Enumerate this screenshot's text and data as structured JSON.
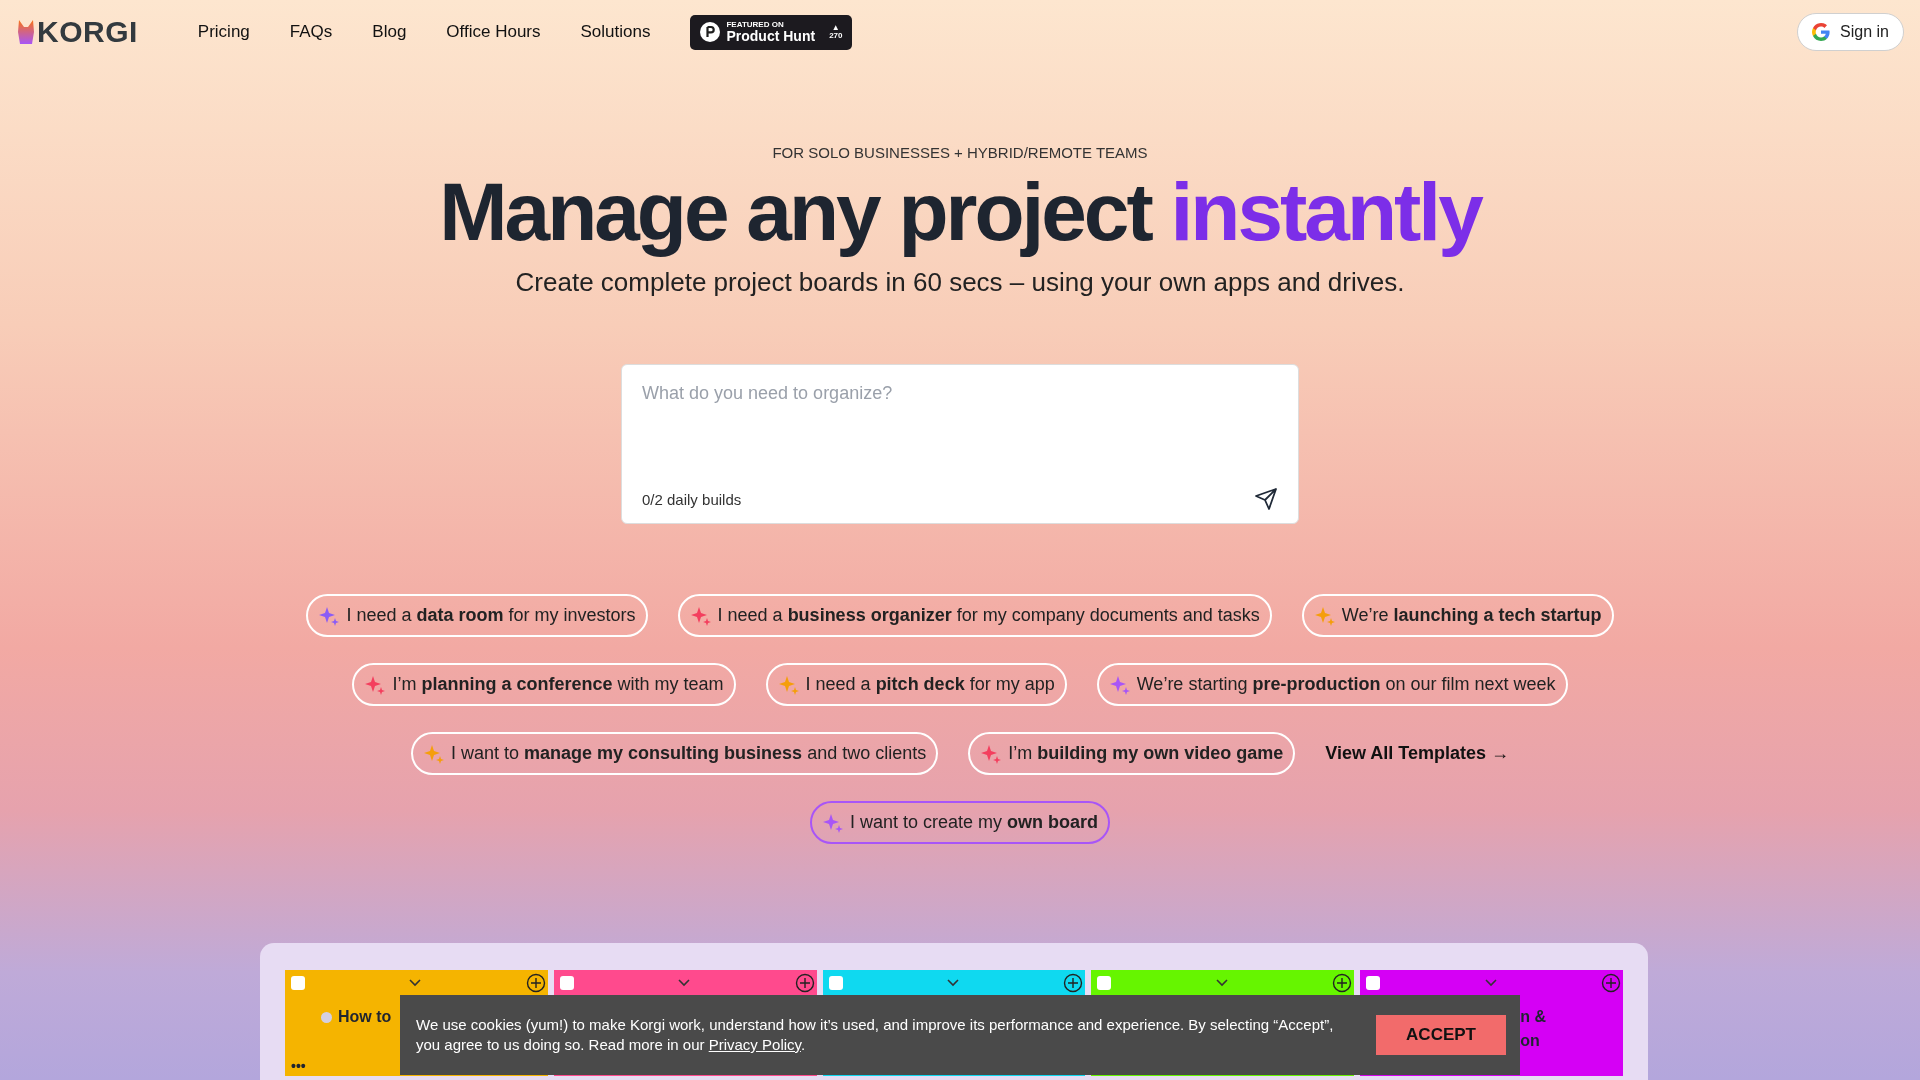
{
  "nav": {
    "logo": "KORGI",
    "links": [
      "Pricing",
      "FAQs",
      "Blog",
      "Office Hours",
      "Solutions"
    ],
    "badge": {
      "small": "FEATURED ON",
      "big": "Product Hunt",
      "votes_mark": "▲",
      "votes": "270"
    },
    "sign_in": "Sign in"
  },
  "hero": {
    "kicker": "FOR SOLO BUSINESSES + HYBRID/REMOTE TEAMS",
    "title": "Manage any project",
    "title_accent": "instantly",
    "subtitle": "Create complete project boards in 60 secs – using your own apps and drives."
  },
  "prompt": {
    "placeholder": "What do you need to organize?",
    "counter": "0/2 daily builds"
  },
  "chip_rows": [
    [
      {
        "text": "I need a **data room** for my investors",
        "color": "#8b5cf6",
        "selected": false
      },
      {
        "text": "I need a **business organizer** for my company documents and tasks",
        "color": "#f43f5e",
        "selected": false
      },
      {
        "text": "We’re **launching a tech startup**",
        "color": "#f59e0b",
        "selected": false
      }
    ],
    [
      {
        "text": "I’m **planning a conference** with my team",
        "color": "#f43f5e",
        "selected": false
      },
      {
        "text": "I need a **pitch deck** for my app",
        "color": "#f59e0b",
        "selected": false
      },
      {
        "text": "We’re starting **pre-production** on our film next week",
        "color": "#a855f7",
        "selected": false
      }
    ],
    [
      {
        "text": "I want to **manage my consulting business** and two clients",
        "color": "#f59e0b",
        "selected": false
      },
      {
        "text": "I’m **building my own video game**",
        "color": "#f43f5e",
        "selected": false
      }
    ],
    [
      {
        "text": "I want to create my **own board**",
        "color": "#a855f7",
        "selected": true
      }
    ]
  ],
  "view_all": "View All Templates →",
  "board": {
    "columns": [
      {
        "color": "#f5b400",
        "checked": false,
        "card_title": "How to",
        "menu": "•••"
      },
      {
        "color": "#ff4a8d",
        "checked": false
      },
      {
        "color": "#0fd9f0",
        "checked": false
      },
      {
        "color": "#66f500",
        "checked": false
      },
      {
        "color": "#d500f5",
        "checked": false,
        "card_lines": [
          "n &",
          "on"
        ]
      }
    ]
  },
  "cookie": {
    "text": "We use cookies (yum!) to make Korgi work, understand how it’s used, and improve its performance and experience. By selecting “Accept”, you agree to us doing so. Read more in our",
    "link": "Privacy Policy",
    "end": ".",
    "button": "ACCEPT"
  }
}
